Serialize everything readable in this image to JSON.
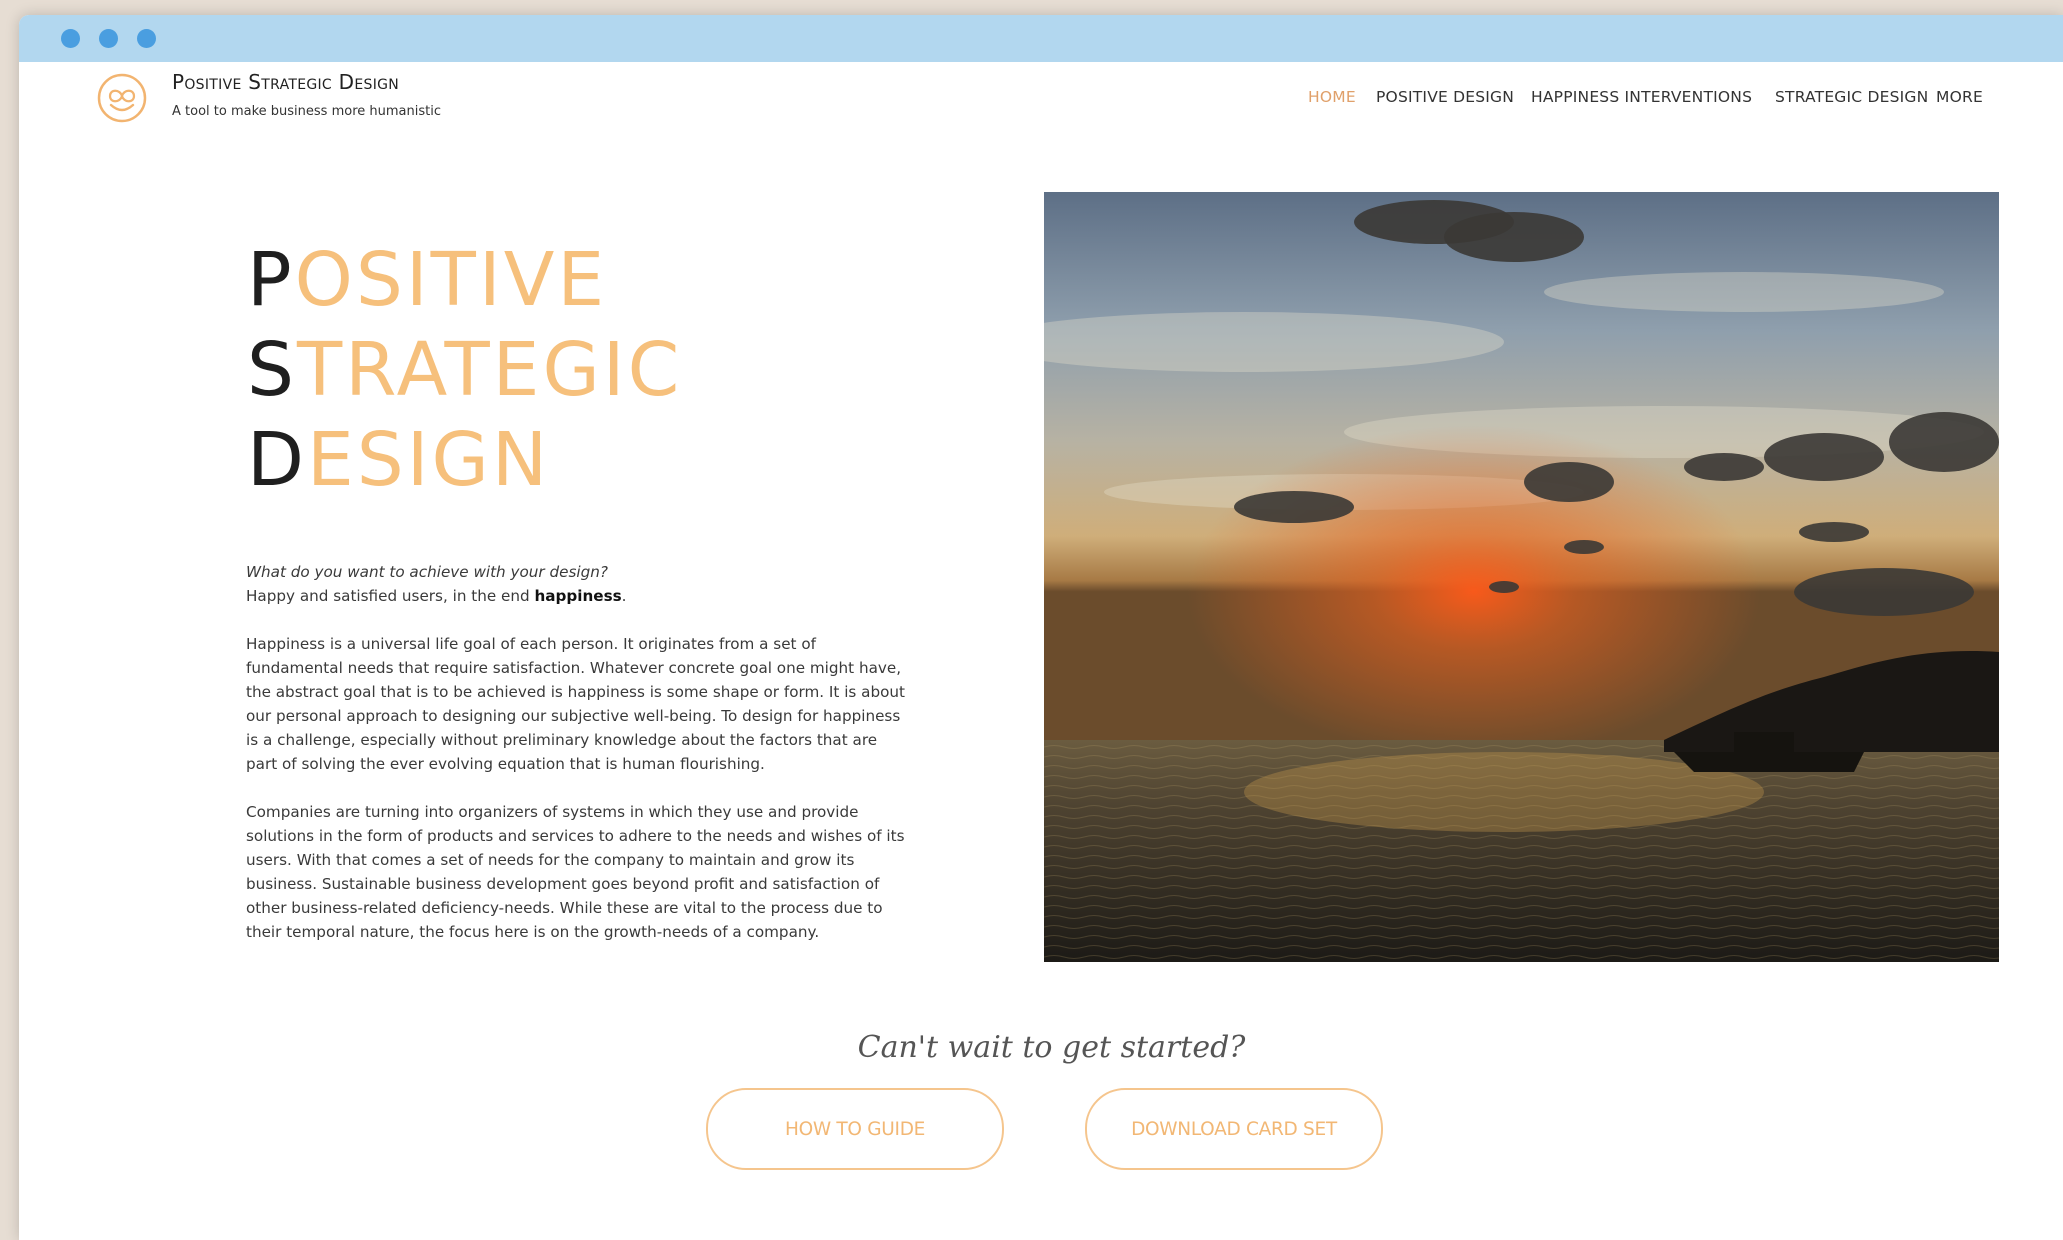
{
  "browser": {
    "dots": [
      "red-dot",
      "yellow-dot",
      "green-dot"
    ]
  },
  "header": {
    "logo_icon": "smiley-loop-icon",
    "title": "Positive Strategic Design",
    "tagline": "A tool to make business more humanistic"
  },
  "nav": {
    "items": [
      {
        "label": "HOME",
        "active": true
      },
      {
        "label": "POSITIVE DESIGN",
        "active": false
      },
      {
        "label": "HAPPINESS INTERVENTIONS",
        "active": false
      },
      {
        "label": "STRATEGIC DESIGN",
        "active": false
      },
      {
        "label": "MORE",
        "active": false
      }
    ]
  },
  "hero": {
    "lines": [
      {
        "initial": "P",
        "rest": "OSITIVE"
      },
      {
        "initial": "S",
        "rest": "TRATEGIC"
      },
      {
        "initial": "D",
        "rest": "ESIGN"
      }
    ]
  },
  "intro": {
    "question": "What do you want to achieve with your design?",
    "answer_prefix": "Happy and satisfied users, in the end ",
    "answer_bold": "happiness",
    "answer_suffix": ".",
    "paragraph_1": "Happiness is a universal life goal of each person. It originates from a set of fundamental needs that require satisfaction. Whatever concrete goal one might have, the abstract goal that is to be achieved is happiness is some shape or form. It is about our personal approach to designing our subjective well-being. To design for happiness is a challenge, especially without preliminary knowledge about the factors that are part of solving the ever evolving equation that is human flourishing.",
    "paragraph_2": "Companies are turning into organizers of systems in which they use and provide solutions in the form of products and services to adhere to the needs and wishes of its users. With that comes a set of needs for the company to maintain and grow its business. Sustainable business development goes beyond profit and satisfaction of other business-related deficiency-needs. While these are vital to the process due to their temporal nature, the focus here is on the growth-needs of a company."
  },
  "photo": {
    "subject": "sunset-over-sea-with-boat"
  },
  "cta": {
    "text": "Can't wait to get started?",
    "button_1": "HOW TO GUIDE",
    "button_2": "DOWNLOAD CARD SET"
  },
  "colors": {
    "accent": "#f6c07c",
    "nav_active": "#e0a06a",
    "titlebar": "#b2d7ef",
    "dots": "#4a9ee0"
  }
}
